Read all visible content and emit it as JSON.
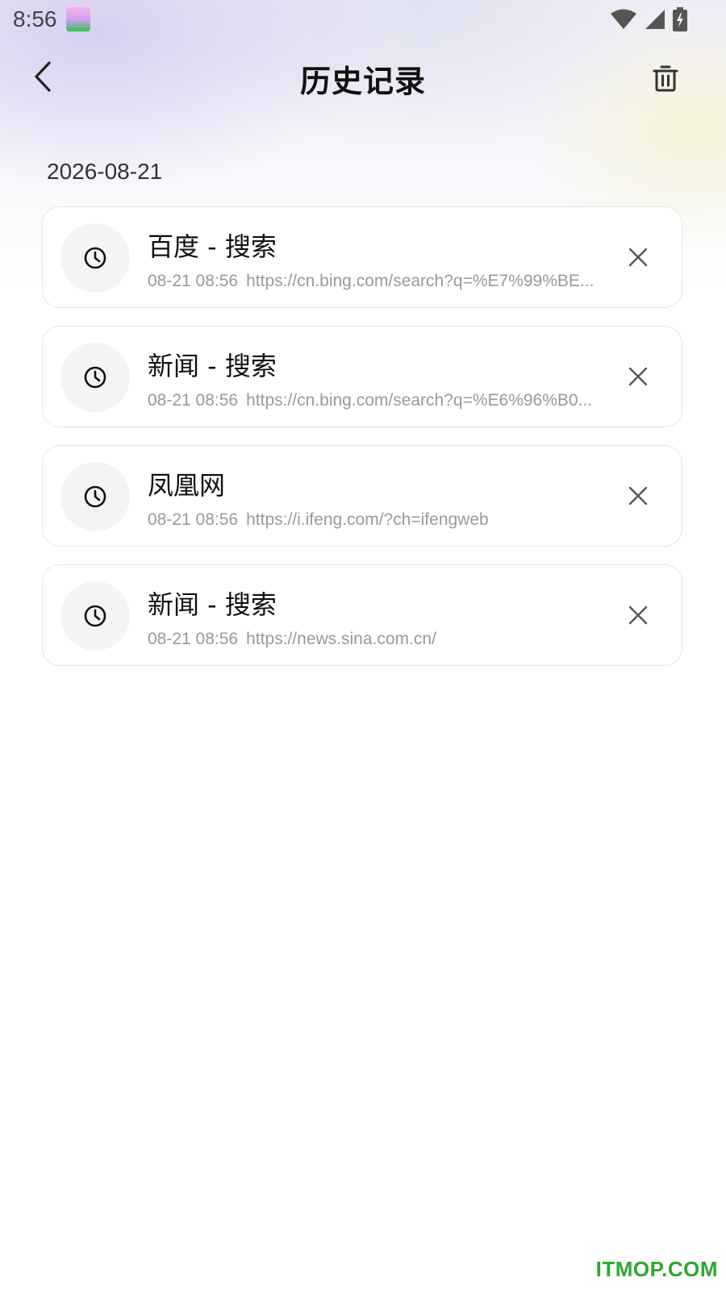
{
  "status_bar": {
    "time": "8:56",
    "app_icon": "app-notification-icon",
    "icons": [
      "wifi-icon",
      "signal-icon",
      "battery-charging-icon"
    ]
  },
  "header": {
    "title": "历史记录",
    "back_icon": "chevron-left-icon",
    "trash_icon": "trash-icon"
  },
  "history": {
    "date": "2026-08-21",
    "items": [
      {
        "title": "百度 - 搜索",
        "time": "08-21 08:56",
        "url": "https://cn.bing.com/search?q=%E7%99%BE..."
      },
      {
        "title": "新闻 - 搜索",
        "time": "08-21 08:56",
        "url": "https://cn.bing.com/search?q=%E6%96%B0..."
      },
      {
        "title": "凤凰网",
        "time": "08-21 08:56",
        "url": "https://i.ifeng.com/?ch=ifengweb"
      },
      {
        "title": "新闻 - 搜索",
        "time": "08-21 08:56",
        "url": "https://news.sina.com.cn/"
      }
    ]
  },
  "watermark": "ITMOP.COM",
  "colors": {
    "watermark": "#2fa62f",
    "card_border": "#e6e6e6",
    "meta_text": "#999999",
    "icon_circle": "#f4f4f4"
  }
}
